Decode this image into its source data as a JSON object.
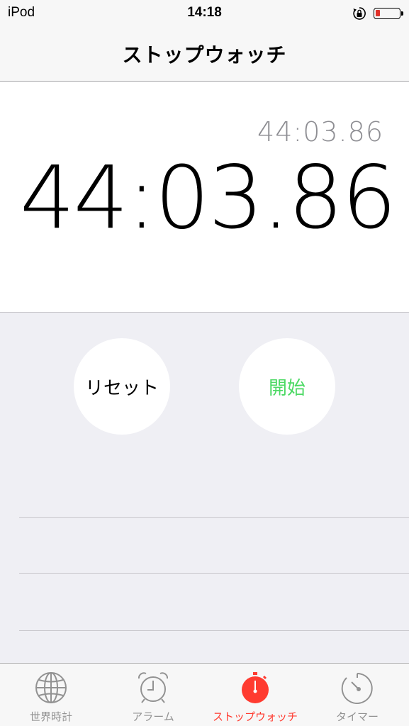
{
  "status_bar": {
    "device": "iPod",
    "time": "14:18",
    "battery_level": 0.18,
    "battery_color": "#e0312a"
  },
  "nav": {
    "title": "ストップウォッチ"
  },
  "timer": {
    "lap_time": "44:03.86",
    "main_time": "44:03.86"
  },
  "controls": {
    "reset_label": "リセット",
    "start_label": "開始",
    "start_color": "#4cd964"
  },
  "tabs": [
    {
      "label": "世界時計",
      "icon": "globe-icon",
      "active": false
    },
    {
      "label": "アラーム",
      "icon": "alarm-clock-icon",
      "active": false
    },
    {
      "label": "ストップウォッチ",
      "icon": "stopwatch-icon",
      "active": true
    },
    {
      "label": "タイマー",
      "icon": "timer-icon",
      "active": false
    }
  ],
  "colors": {
    "accent": "#ff3b30",
    "inactive": "#929292"
  }
}
